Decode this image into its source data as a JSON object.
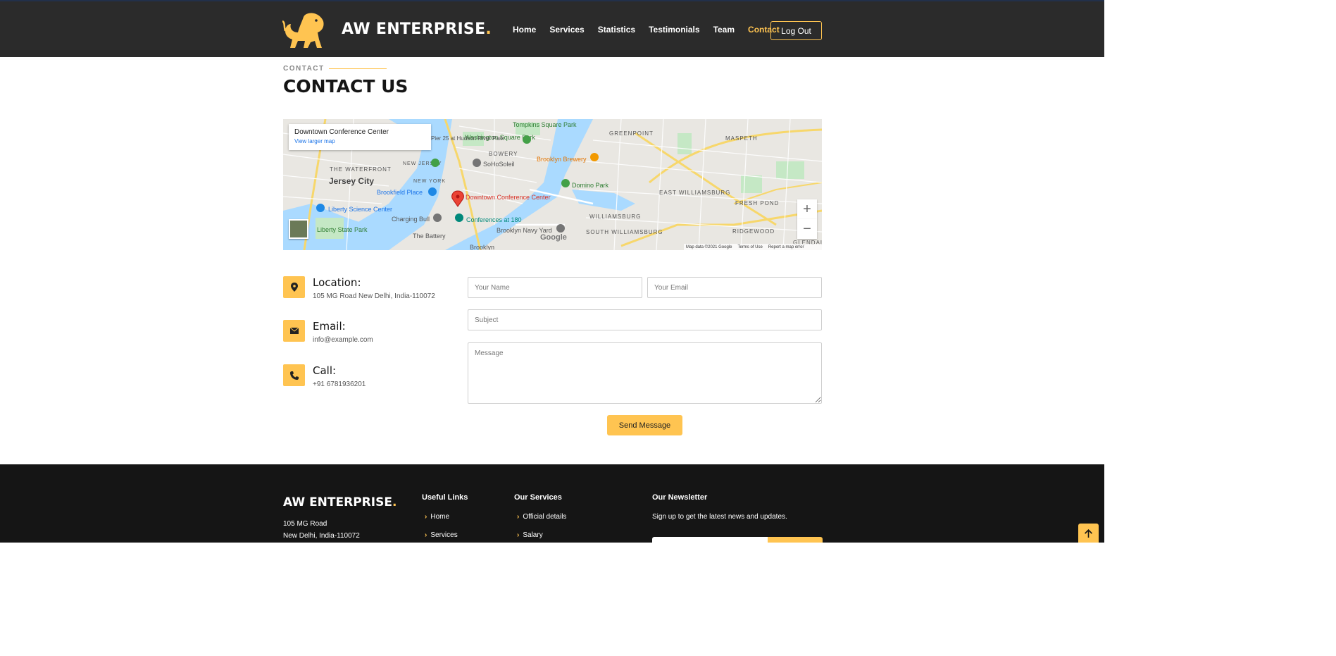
{
  "header": {
    "brand": "AW ENTERPRISE",
    "brand_dot": ".",
    "nav": [
      "Home",
      "Services",
      "Statistics",
      "Testimonials",
      "Team",
      "Contact"
    ],
    "active_nav": "Contact",
    "logout_label": "Log Out"
  },
  "section": {
    "label": "CONTACT",
    "title": "CONTACT US"
  },
  "map": {
    "place_title": "Downtown Conference Center",
    "larger_map_link": "View larger map",
    "labels": {
      "jersey_city": "Jersey City",
      "waterfront": "THE WATERFRONT",
      "brookfield": "Brookfield Place",
      "liberty_center": "Liberty Science Center",
      "liberty_park": "Liberty State Park",
      "charging_bull": "Charging Bull",
      "battery": "The Battery",
      "downtown": "Downtown Conference Center",
      "conferences": "Conferences at 180",
      "navy_yard": "Brooklyn Navy Yard",
      "brooklyn": "Brooklyn",
      "bowery": "BOWERY",
      "sohosoleil": "SoHoSoleil",
      "washington_park": "Washington Square Park",
      "tompkins": "Tompkins Square Park",
      "brooklyn_brewery": "Brooklyn Brewery",
      "domino_park": "Domino Park",
      "greenpoint": "GREENPOINT",
      "maspeth": "MASPETH",
      "east_williamsburg": "EAST WILLIAMSBURG",
      "williamsburg": "WILLIAMSBURG",
      "south_williamsburg": "SOUTH WILLIAMSBURG",
      "fresh_pond": "FRESH POND",
      "ridgewood": "RIDGEWOOD",
      "glendale": "GLENDALE",
      "pier25": "Pier 25 at Hudson River Park",
      "new_jersey": "NEW JERSEY",
      "new_york": "NEW YORK"
    },
    "zoom_in": "+",
    "zoom_out": "−",
    "google": "Google",
    "footer": [
      "Map data ©2021 Google",
      "Terms of Use",
      "Report a map error"
    ]
  },
  "info": {
    "location_title": "Location:",
    "location_value": "105 MG Road New Delhi, India-110072",
    "email_title": "Email:",
    "email_value": "info@example.com",
    "call_title": "Call:",
    "call_value": "+91 6781936201"
  },
  "form": {
    "name_placeholder": "Your Name",
    "email_placeholder": "Your Email",
    "subject_placeholder": "Subject",
    "message_placeholder": "Message",
    "send_label": "Send Message"
  },
  "footer": {
    "brand": "AW ENTERPRISE",
    "brand_dot": ".",
    "address_line1": "105 MG Road",
    "address_line2": "New Delhi, India-110072",
    "useful_links_title": "Useful Links",
    "useful_links": [
      "Home",
      "Services"
    ],
    "services_title": "Our Services",
    "services": [
      "Official details",
      "Salary"
    ],
    "newsletter_title": "Our Newsletter",
    "newsletter_text": "Sign up to get the latest news and updates."
  },
  "colors": {
    "accent": "#ffc451",
    "header_bg": "#2b2b2b",
    "footer_bg": "#151515"
  }
}
